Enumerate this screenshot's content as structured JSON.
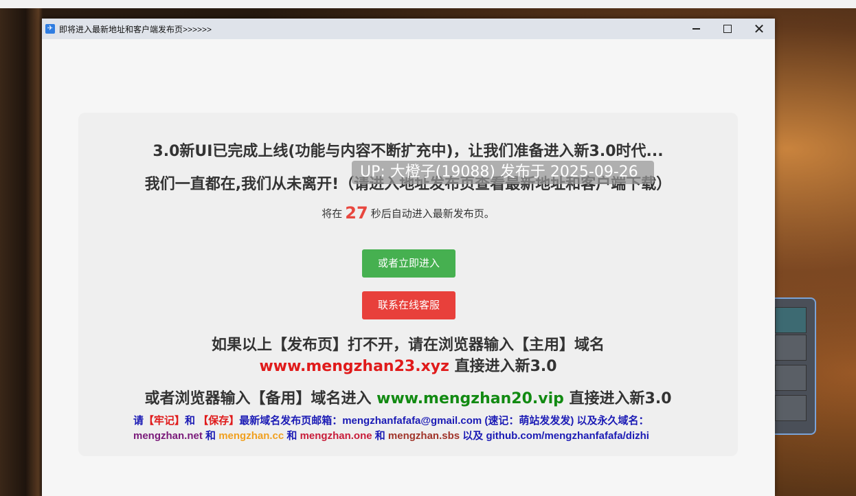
{
  "window": {
    "title": "即将进入最新地址和客户端发布页>>>>>>",
    "icon": "app-icon"
  },
  "overlay": {
    "text": "UP: 大橙子(19088) 发布于 2025-09-26"
  },
  "announcement": {
    "line1": "3.0新UI已完成上线(功能与内容不断扩充中)，让我们准备进入新3.0时代...",
    "line2": "我们一直都在,我们从未离开!（请进入地址发布页查看最新地址和客户端下载）"
  },
  "countdown": {
    "prefix": "将在",
    "seconds": "27",
    "suffix": "秒后自动进入最新发布页。"
  },
  "buttons": {
    "enter_now": "或者立即进入",
    "contact": "联系在线客服"
  },
  "fallback": {
    "line1": "如果以上【发布页】打不开，请在浏览器输入【主用】域名",
    "primary_domain": "www.mengzhan23.xyz",
    "line2_suffix": " 直接进入新3.0",
    "line3_prefix": "或者浏览器输入【备用】域名进入 ",
    "backup_domain": "www.mengzhan20.vip",
    "line3_suffix": " 直接进入新3.0"
  },
  "email": {
    "p1": "请",
    "remember": "【牢记】",
    "and1": "和 ",
    "save": "【保存】",
    "p2": "最新域名发布页邮箱：mengzhanfafafa@gmail.com (速记：萌站发发发) 以及永久域名：",
    "d1": "mengzhan.net",
    "and2": " 和 ",
    "d2": "mengzhan.cc",
    "and3": " 和 ",
    "d3": "mengzhan.one",
    "and4": " 和 ",
    "d4": "mengzhan.sbs",
    "and5": " 以及 ",
    "d5": "github.com/mengzhanfafafa/dizhi"
  },
  "colors": {
    "green_button": "#46b050",
    "red_button": "#e8403b",
    "countdown_number": "#e8473f"
  }
}
